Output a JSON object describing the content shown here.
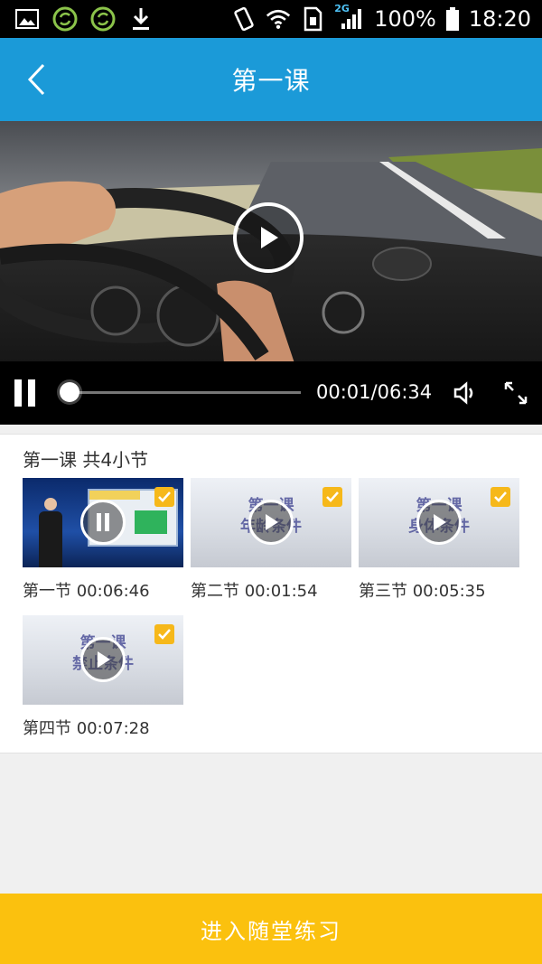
{
  "status_bar": {
    "battery": "100%",
    "time": "18:20",
    "network": "2G",
    "icons": [
      "gallery-icon",
      "sync-icon",
      "sync-icon",
      "download-icon",
      "vibrate-icon",
      "wifi-icon",
      "sim-icon",
      "signal-icon",
      "battery-icon"
    ]
  },
  "header": {
    "title": "第一课",
    "back_icon": "chevron-left-icon"
  },
  "player": {
    "current_time": "00:01",
    "total_time": "06:34",
    "time_display": "00:01/06:34",
    "progress_fraction": 0.003,
    "state": "paused-overlay-visible"
  },
  "lesson": {
    "heading": "第一课 共4小节",
    "sections": [
      {
        "label": "第一节 00:06:46",
        "thumb_text": "",
        "checked": true,
        "kind": "presenter"
      },
      {
        "label": "第二节 00:01:54",
        "thumb_text": "第一课\n年龄条件",
        "checked": true,
        "kind": "title"
      },
      {
        "label": "第三节 00:05:35",
        "thumb_text": "第一课\n身体条件",
        "checked": true,
        "kind": "title"
      },
      {
        "label": "第四节 00:07:28",
        "thumb_text": "第一课\n禁止条件",
        "checked": true,
        "kind": "title"
      }
    ]
  },
  "footer": {
    "button_label": "进入随堂练习"
  },
  "colors": {
    "header": "#1b9ad8",
    "accent": "#fbc10e",
    "check": "#f6b81a"
  }
}
